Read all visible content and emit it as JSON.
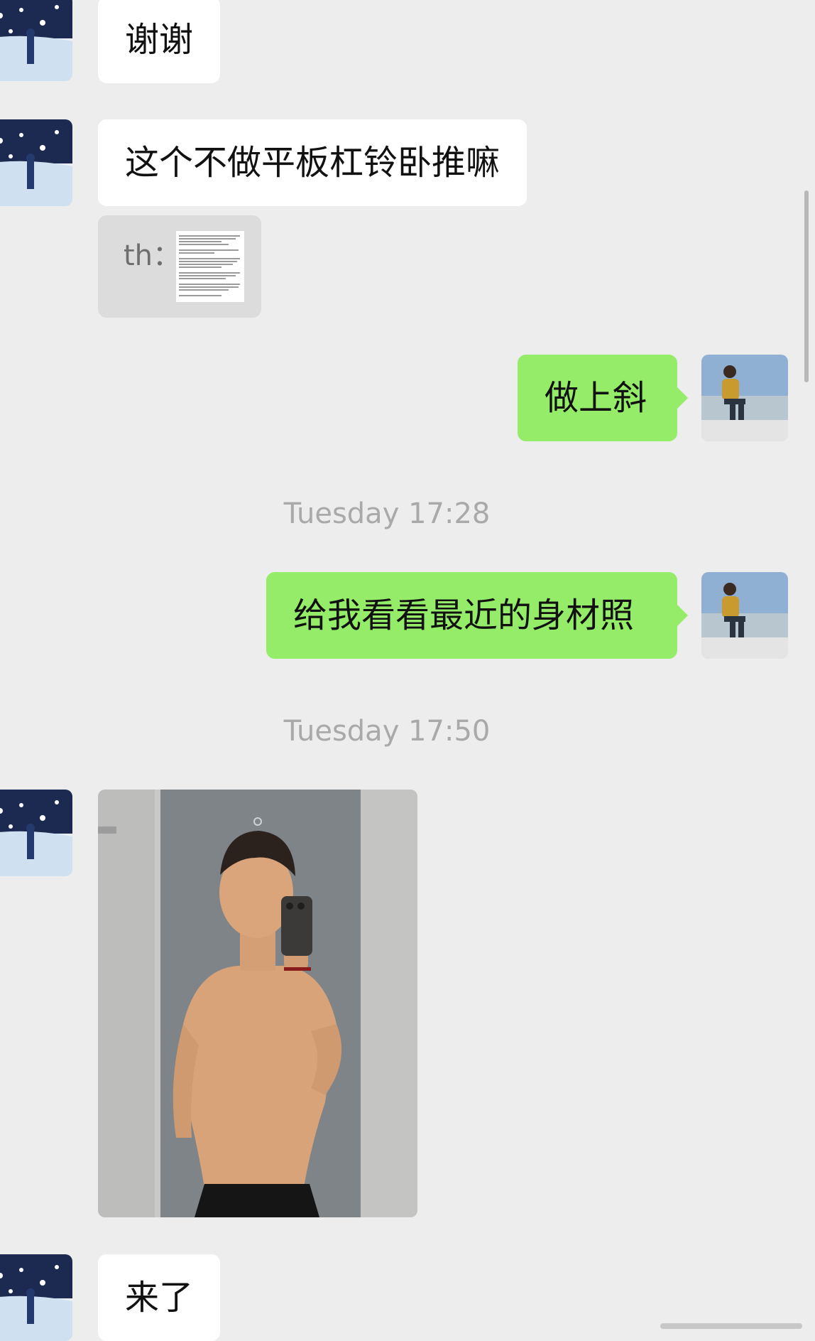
{
  "messages": [
    {
      "sender": "contact",
      "type": "text",
      "text": "谢谢"
    },
    {
      "sender": "contact",
      "type": "text",
      "text": "这个不做平板杠铃卧推嘛"
    },
    {
      "sender": "contact",
      "type": "quote",
      "label": "th："
    },
    {
      "sender": "me",
      "type": "text",
      "text": "做上斜"
    },
    {
      "sender": "system",
      "type": "timestamp",
      "text": "Tuesday 17:28"
    },
    {
      "sender": "me",
      "type": "text",
      "text": "给我看看最近的身材照"
    },
    {
      "sender": "system",
      "type": "timestamp",
      "text": "Tuesday 17:50"
    },
    {
      "sender": "contact",
      "type": "image"
    },
    {
      "sender": "contact",
      "type": "text",
      "text": "来了"
    }
  ],
  "colors": {
    "background": "#ededed",
    "incoming_bubble": "#ffffff",
    "outgoing_bubble": "#95ec69",
    "timestamp_text": "#a9a9a9"
  }
}
